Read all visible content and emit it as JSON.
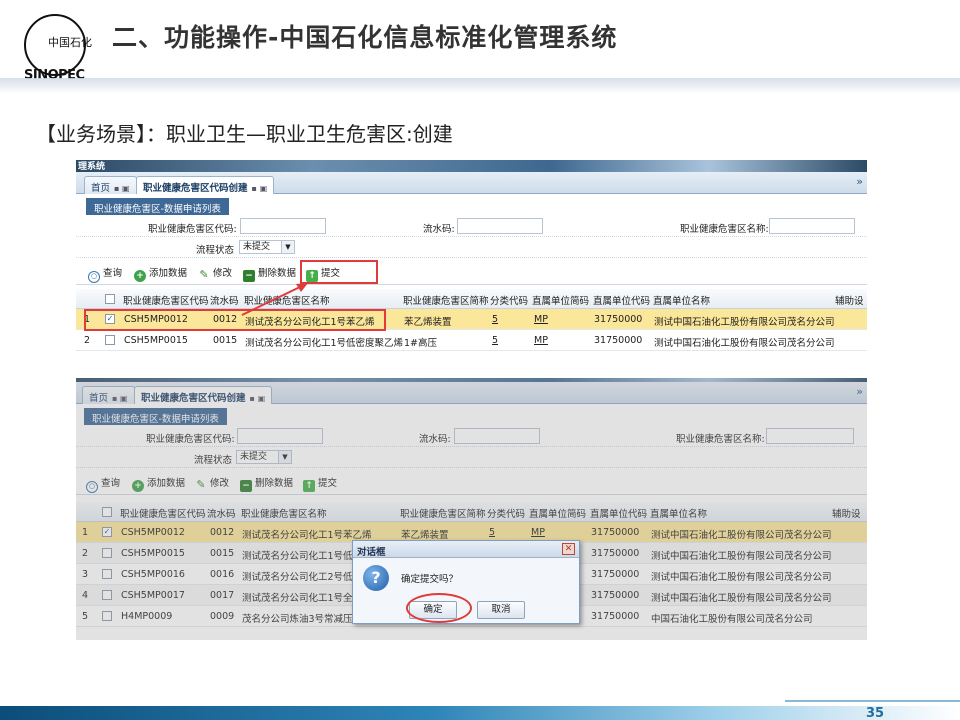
{
  "slide": {
    "title": "二、功能操作-中国石化信息标准化管理系统",
    "scene": "【业务场景】：职业卫生—职业卫生危害区:创建",
    "page_number": "35",
    "logo_text": "中国石化",
    "logo_word": "SINOPEC"
  },
  "app": {
    "banner_text": "理系统",
    "tabs": [
      {
        "label": "首页"
      },
      {
        "label": "职业健康危害区代码创建"
      }
    ],
    "panel_title": "职业健康危害区-数据申请列表",
    "search": {
      "code_label": "职业健康危害区代码:",
      "serial_label": "流水码:",
      "name_label": "职业健康危害区名称:",
      "status_label": "流程状态",
      "status_value": "未提交"
    },
    "toolbar": {
      "query": "查询",
      "add": "添加数据",
      "edit": "修改",
      "delete": "删除数据",
      "submit": "提交"
    },
    "columns": [
      "职业健康危害区代码",
      "流水码",
      "职业健康危害区名称",
      "职业健康危害区简称",
      "分类代码",
      "直属单位简码",
      "直属单位代码",
      "直属单位名称",
      "辅助设"
    ],
    "rows_top": [
      {
        "no": "1",
        "checked": "✓",
        "code": "CSH5MP0012",
        "serial": "0012",
        "name": "测试茂名分公司化工1号苯乙烯",
        "short": "苯乙烯装置",
        "cat": "5",
        "unit_abbr": "MP",
        "unit_code": "31750000",
        "unit_name": "测试中国石油化工股份有限公司茂名分公司"
      },
      {
        "no": "2",
        "checked": "",
        "code": "CSH5MP0015",
        "serial": "0015",
        "name": "测试茂名分公司化工1号低密度聚乙烯",
        "short": "1#高压",
        "cat": "5",
        "unit_abbr": "MP",
        "unit_code": "31750000",
        "unit_name": "测试中国石油化工股份有限公司茂名分公司"
      }
    ],
    "rows_bottom": [
      {
        "no": "1",
        "checked": "✓",
        "code": "CSH5MP0012",
        "serial": "0012",
        "name": "测试茂名分公司化工1号苯乙烯",
        "short": "苯乙烯装置",
        "cat": "5",
        "unit_abbr": "MP",
        "unit_code": "31750000",
        "unit_name": "测试中国石油化工股份有限公司茂名分公司"
      },
      {
        "no": "2",
        "checked": "",
        "code": "CSH5MP0015",
        "serial": "0015",
        "name": "测试茂名分公司化工1号低",
        "short": "",
        "cat": "",
        "unit_abbr": "",
        "unit_code": "31750000",
        "unit_name": "测试中国石油化工股份有限公司茂名分公司"
      },
      {
        "no": "3",
        "checked": "",
        "code": "CSH5MP0016",
        "serial": "0016",
        "name": "测试茂名分公司化工2号低",
        "short": "",
        "cat": "",
        "unit_abbr": "",
        "unit_code": "31750000",
        "unit_name": "测试中国石油化工股份有限公司茂名分公司"
      },
      {
        "no": "4",
        "checked": "",
        "code": "CSH5MP0017",
        "serial": "0017",
        "name": "测试茂名分公司化工1号全",
        "short": "",
        "cat": "",
        "unit_abbr": "",
        "unit_code": "31750000",
        "unit_name": "测试中国石油化工股份有限公司茂名分公司"
      },
      {
        "no": "5",
        "checked": "",
        "code": "H4MP0009",
        "serial": "0009",
        "name": "茂名分公司炼油3号常减压",
        "short": "",
        "cat": "",
        "unit_abbr": "",
        "unit_code": "31750000",
        "unit_name": "中国石油化工股份有限公司茂名分公司"
      }
    ],
    "dialog": {
      "title": "对话框",
      "message": "确定提交吗？",
      "ok": "确定",
      "cancel": "取消"
    }
  },
  "colors": {
    "selected_row": "#fbe79a",
    "highlight": "#e03a3a",
    "panel_title_bg": "#3e6896"
  }
}
